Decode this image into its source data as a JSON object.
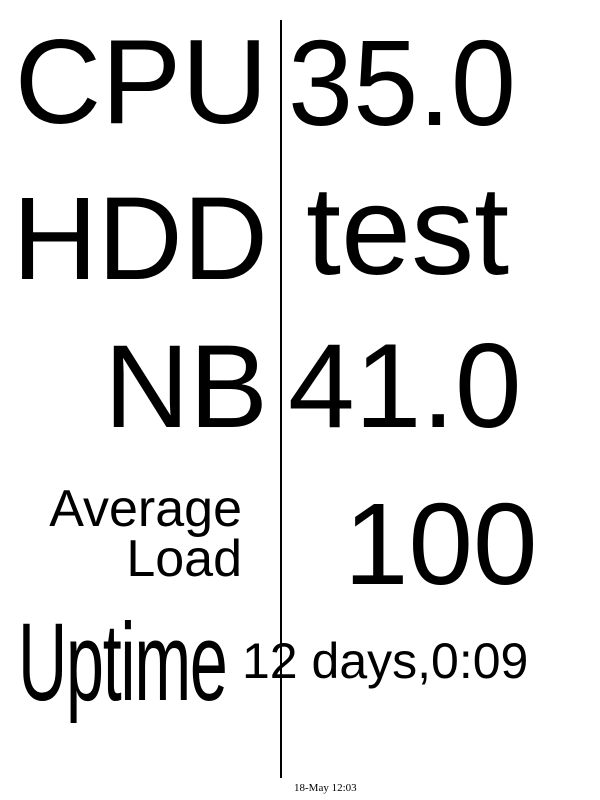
{
  "rows": {
    "cpu": {
      "label": "CPU",
      "value": "35.0"
    },
    "hdd": {
      "label": "HDD",
      "value": "test"
    },
    "nb": {
      "label": "NB",
      "value": "41.0"
    },
    "average_load": {
      "label_line1": "Average",
      "label_line2": "Load",
      "value": "100"
    },
    "uptime": {
      "label": "Uptime",
      "value": "12 days,0:09"
    }
  },
  "footer": {
    "timestamp": "18-May 12:03"
  },
  "colors": {
    "background": "#ffffff",
    "text": "#000000",
    "divider": "#000000"
  }
}
